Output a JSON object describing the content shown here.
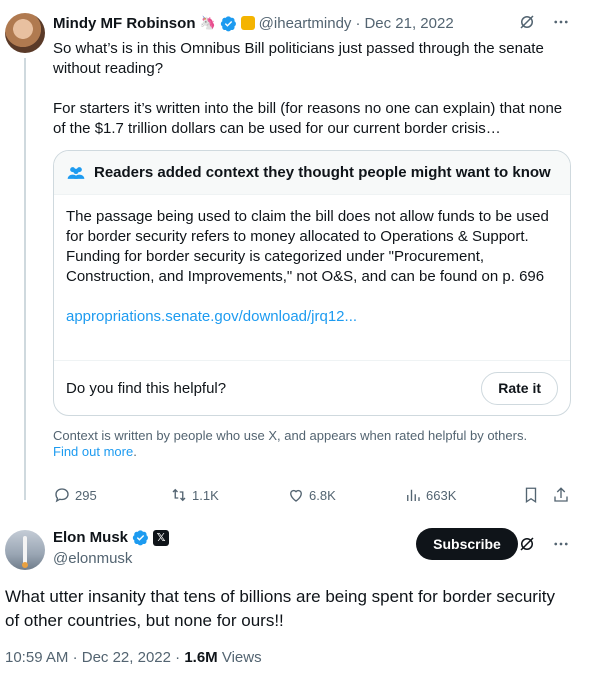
{
  "tweet1": {
    "author_name": "Mindy MF Robinson",
    "handle": "@iheartmindy",
    "separator": "·",
    "date": "Dec 21, 2022",
    "icons": [
      "unicorn-emoji",
      "verified-badge",
      "yellow-badge"
    ],
    "paragraphs": [
      "So what’s is in this Omnibus Bill politicians just passed through the senate without reading?",
      "For starters it’s written into the bill (for reasons no one can explain) that none of the $1.7 trillion dollars can be used for our current border crisis…"
    ],
    "note": {
      "header": "Readers added context they thought people might want to know",
      "body": "The passage being used to claim the bill does not allow funds to be used for border security refers to money allocated to Operations & Support. Funding for border security is categorized under \"Procurement, Construction, and Improvements,\" not O&S, and can be found on p. 696",
      "link": "appropriations.senate.gov/download/jrq12...",
      "helpful_question": "Do you find this helpful?",
      "rate_button": "Rate it"
    },
    "context_info": "Context is written by people who use X, and appears when rated helpful by others.",
    "find_out_more": "Find out more",
    "find_out_more_suffix": ".",
    "stats": {
      "replies": "295",
      "reposts": "1.1K",
      "likes": "6.8K",
      "views": "663K"
    }
  },
  "tweet2": {
    "author_name": "Elon Musk",
    "x_badge": "𝕏",
    "handle": "@elonmusk",
    "subscribe_label": "Subscribe",
    "text": "What utter insanity that tens of billions are being spent for border security of other countries, but none for ours!!",
    "time": "10:59 AM",
    "separator": "·",
    "date": "Dec 22, 2022",
    "separator2": "·",
    "views_count": "1.6M",
    "views_label": "Views"
  },
  "colors": {
    "accent": "#1d9bf0",
    "text": "#0f1419",
    "secondary": "#536471",
    "border": "#cfd9de"
  }
}
